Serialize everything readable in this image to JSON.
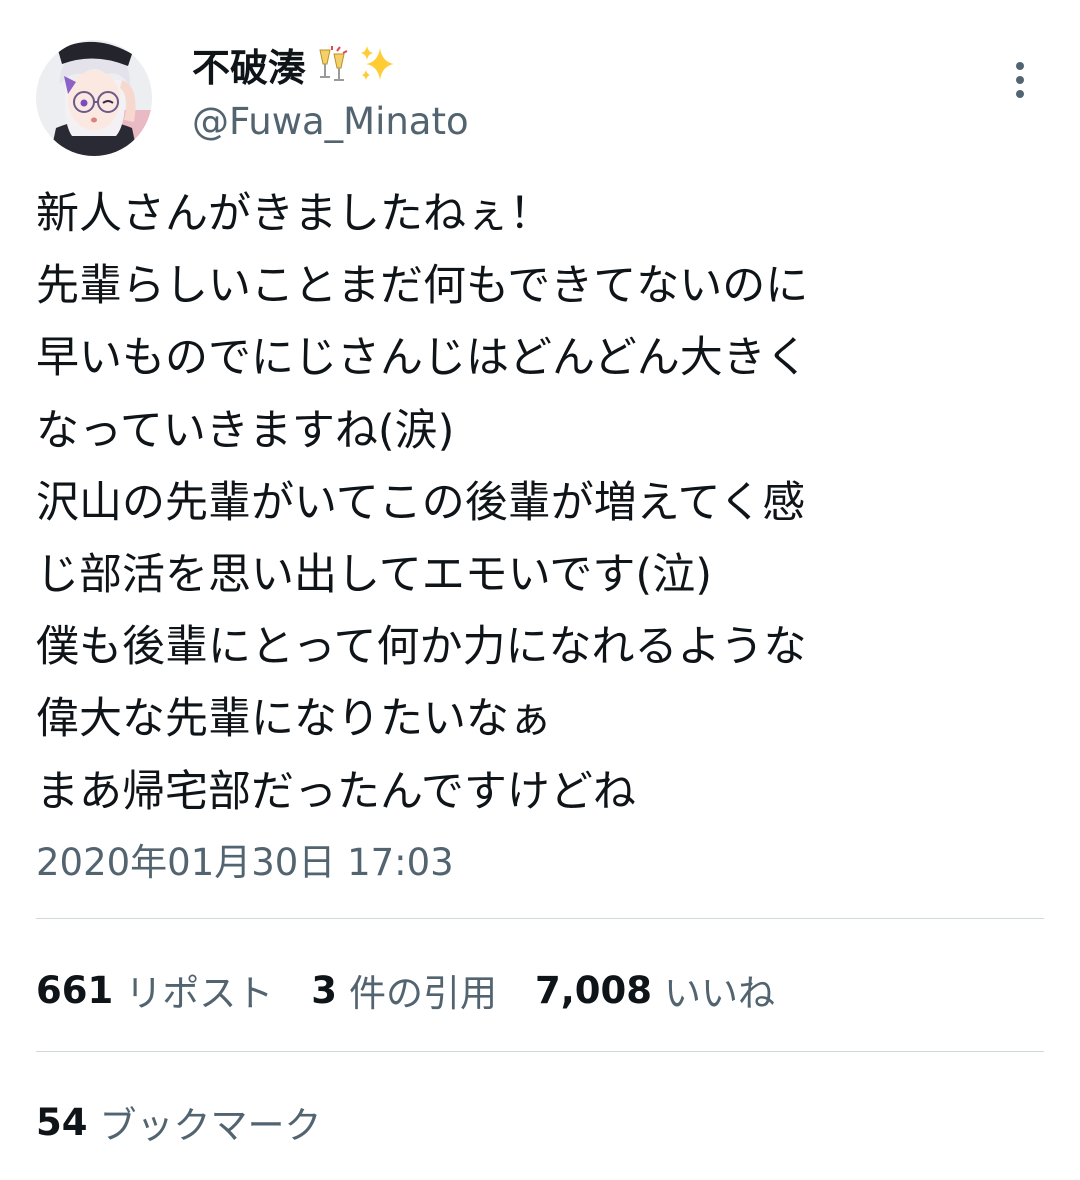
{
  "author": {
    "display_name": "不破湊",
    "handle": "@Fuwa_Minato",
    "name_emojis": [
      "champagne-glasses-emoji",
      "sparkles-emoji"
    ]
  },
  "tweet": {
    "lines": [
      "新人さんがきましたねぇ！",
      "先輩らしいことまだ何もできてないのに",
      "早いものでにじさんじはどんどん大きく",
      "なっていきますね(涙)",
      "沢山の先輩がいてこの後輩が増えてく感",
      "じ部活を思い出してエモいです(泣)",
      "僕も後輩にとって何か力になれるような",
      "偉大な先輩になりたいなぁ",
      "まあ帰宅部だったんですけどね"
    ],
    "timestamp": "2020年01月30日 17:03"
  },
  "stats": {
    "reposts_count": "661",
    "reposts_label": "リポスト",
    "quotes_count": "3",
    "quotes_label": "件の引用",
    "likes_count": "7,008",
    "likes_label": "いいね",
    "bookmarks_count": "54",
    "bookmarks_label": "ブックマーク"
  },
  "colors": {
    "text_primary": "#0f1419",
    "text_secondary": "#536471",
    "divider": "#cfd9de",
    "background": "#ffffff"
  }
}
